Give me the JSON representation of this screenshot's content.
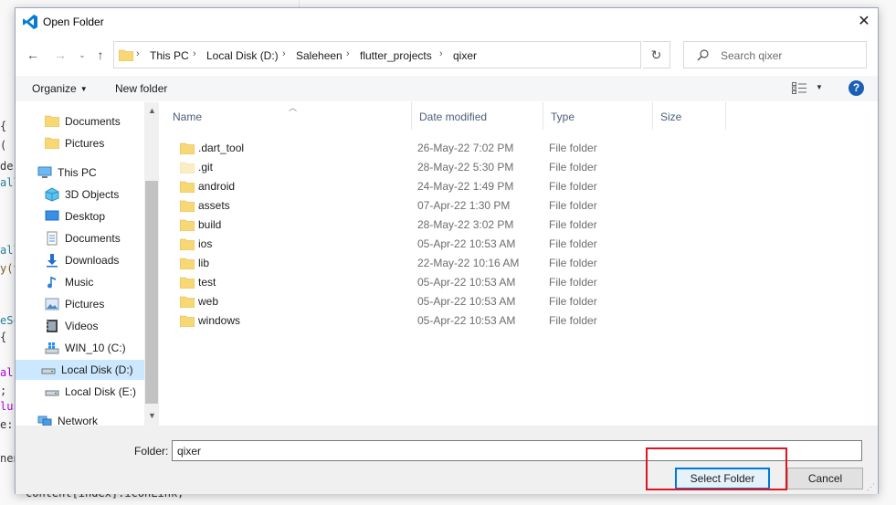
{
  "background_code": {
    "left_fragments": [
      "{",
      "(",
      "der",
      "alla",
      "alla",
      "y(t",
      "eSc",
      " {",
      "al",
      ";",
      "lus",
      "e:",
      "nen"
    ],
    "bottom_line": "content[index].iconLink,"
  },
  "dialog": {
    "title": "Open Folder",
    "close_glyph": "✕"
  },
  "address": {
    "breadcrumbs": [
      "This PC",
      "Local Disk (D:)",
      "Saleheen",
      "flutter_projects",
      "qixer"
    ],
    "search_placeholder": "Search qixer"
  },
  "toolbar": {
    "organize_label": "Organize",
    "new_folder_label": "New folder",
    "help_label": "?"
  },
  "nav_pane": {
    "items": [
      {
        "label": "Documents",
        "icon": "documents-folder-icon"
      },
      {
        "label": "Pictures",
        "icon": "pictures-folder-icon"
      },
      {
        "label": "This PC",
        "icon": "this-pc-icon"
      },
      {
        "label": "3D Objects",
        "icon": "3d-objects-icon"
      },
      {
        "label": "Desktop",
        "icon": "desktop-icon"
      },
      {
        "label": "Documents",
        "icon": "documents-icon"
      },
      {
        "label": "Downloads",
        "icon": "downloads-icon"
      },
      {
        "label": "Music",
        "icon": "music-icon"
      },
      {
        "label": "Pictures",
        "icon": "pictures-icon"
      },
      {
        "label": "Videos",
        "icon": "videos-icon"
      },
      {
        "label": "WIN_10 (C:)",
        "icon": "windows-drive-icon"
      },
      {
        "label": "Local Disk (D:)",
        "icon": "drive-icon",
        "selected": true
      },
      {
        "label": "Local Disk (E:)",
        "icon": "drive-icon"
      },
      {
        "label": "Network",
        "icon": "network-icon"
      }
    ]
  },
  "columns": [
    "Name",
    "Date modified",
    "Type",
    "Size"
  ],
  "files": [
    {
      "name": ".dart_tool",
      "date": "26-May-22 7:02 PM",
      "type": "File folder"
    },
    {
      "name": ".git",
      "date": "28-May-22 5:30 PM",
      "type": "File folder"
    },
    {
      "name": "android",
      "date": "24-May-22 1:49 PM",
      "type": "File folder"
    },
    {
      "name": "assets",
      "date": "07-Apr-22 1:30 PM",
      "type": "File folder"
    },
    {
      "name": "build",
      "date": "28-May-22 3:02 PM",
      "type": "File folder"
    },
    {
      "name": "ios",
      "date": "05-Apr-22 10:53 AM",
      "type": "File folder"
    },
    {
      "name": "lib",
      "date": "22-May-22 10:16 AM",
      "type": "File folder"
    },
    {
      "name": "test",
      "date": "05-Apr-22 10:53 AM",
      "type": "File folder"
    },
    {
      "name": "web",
      "date": "05-Apr-22 10:53 AM",
      "type": "File folder"
    },
    {
      "name": "windows",
      "date": "05-Apr-22 10:53 AM",
      "type": "File folder"
    }
  ],
  "footer": {
    "folder_label": "Folder:",
    "folder_value": "qixer",
    "select_label": "Select Folder",
    "cancel_label": "Cancel"
  },
  "colors": {
    "accent": "#0078d7",
    "highlight": "#e0141e",
    "selection": "#cce8ff",
    "folder": "#f8d775"
  }
}
